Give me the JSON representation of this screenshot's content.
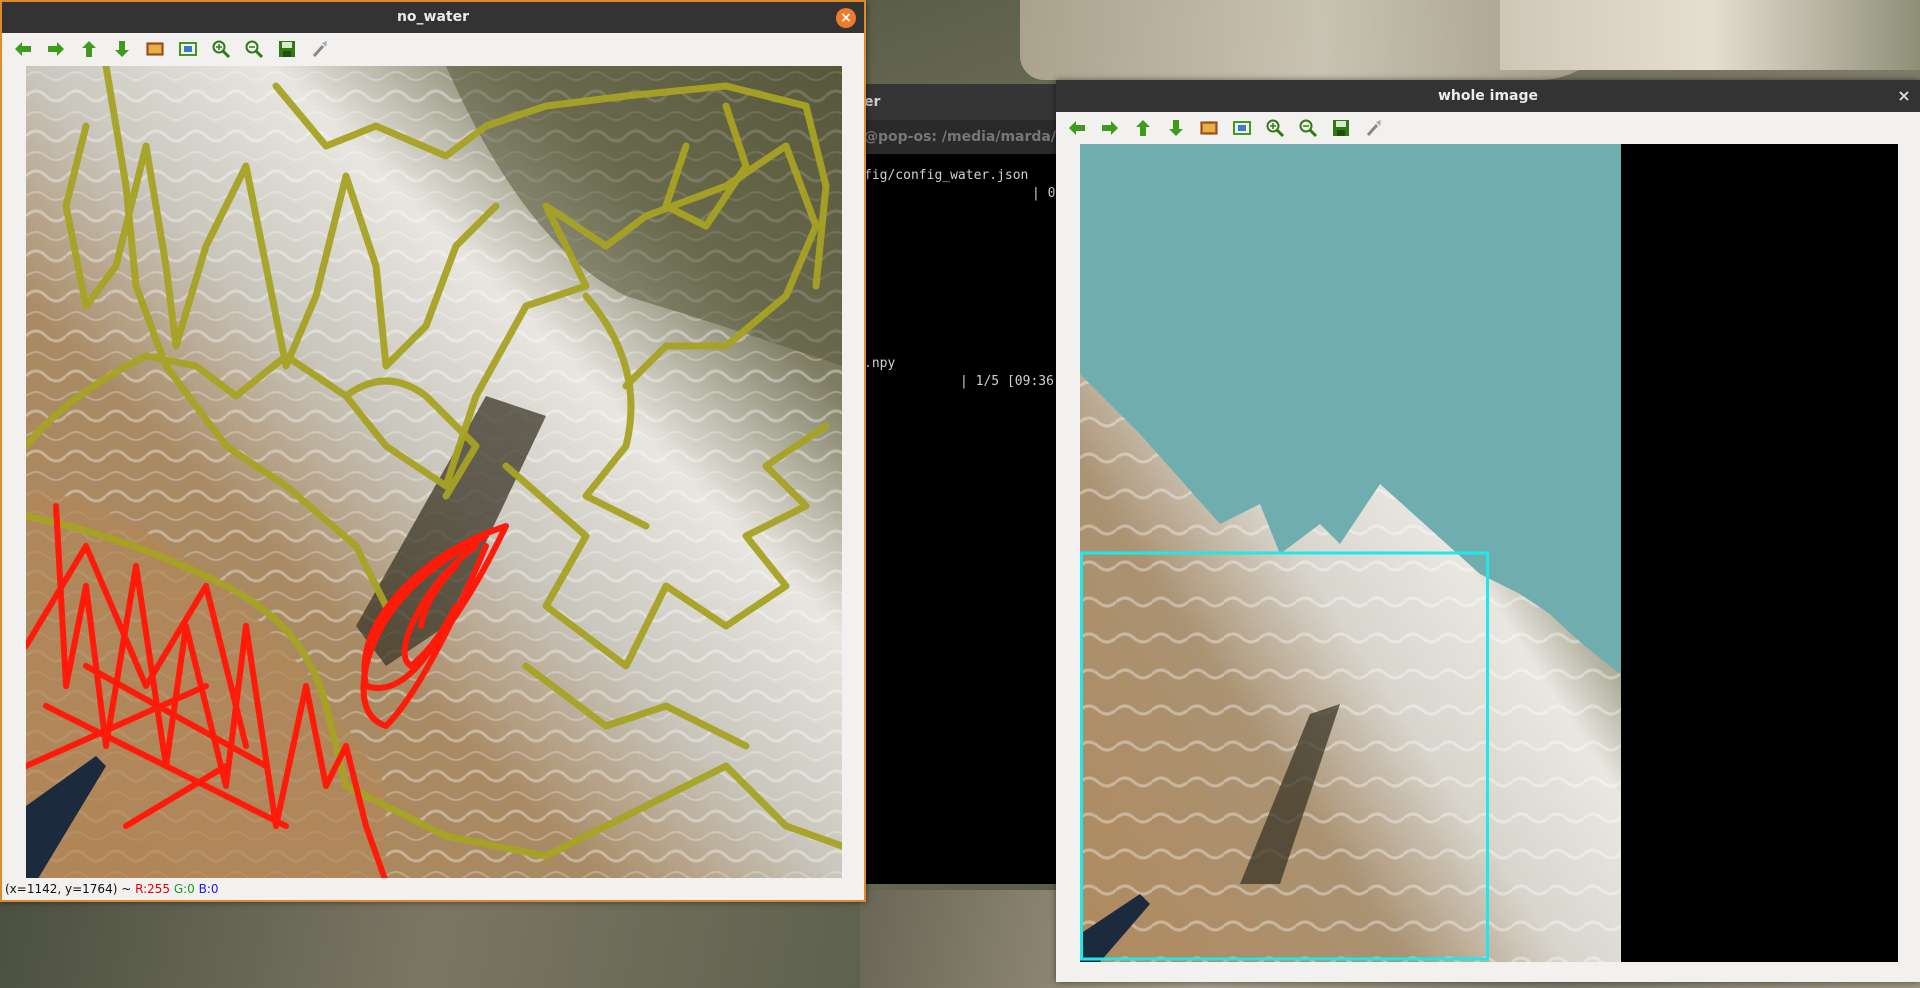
{
  "terminal": {
    "title_fragment": "er",
    "path_fragment": "@pop-os: /media/marda/TWO",
    "lines": [
      {
        "text": "fig/config_water.json"
      },
      {
        "text": "| 0"
      },
      {
        "text": ".npy"
      },
      {
        "text": "| 1/5 [09:36"
      }
    ]
  },
  "window_no_water": {
    "title": "no_water",
    "close_icon": "×",
    "toolbar": [
      {
        "icon": "arrow-left-icon",
        "tooltip": "back"
      },
      {
        "icon": "arrow-right-icon",
        "tooltip": "forward"
      },
      {
        "icon": "arrow-up-icon",
        "tooltip": "up"
      },
      {
        "icon": "arrow-down-icon",
        "tooltip": "down"
      },
      {
        "icon": "image-icon",
        "tooltip": "image"
      },
      {
        "icon": "fit-image-icon",
        "tooltip": "fit"
      },
      {
        "icon": "zoom-in-icon",
        "tooltip": "zoom in"
      },
      {
        "icon": "zoom-out-icon",
        "tooltip": "zoom out"
      },
      {
        "icon": "save-icon",
        "tooltip": "save"
      },
      {
        "icon": "brush-icon",
        "tooltip": "properties"
      }
    ],
    "status": {
      "coords": "(x=1142, y=1764) ~",
      "r": "R:255",
      "g": "G:0",
      "b": "B:0"
    },
    "colors": {
      "annotation_red": "#ff0000",
      "annotation_olive": "#a7a324",
      "accent_border": "#e08a2f"
    }
  },
  "window_whole_image": {
    "title": "whole image",
    "close_icon": "×",
    "colors": {
      "mask_teal": "#6fadae",
      "selection_cyan": "#20e8e8"
    }
  }
}
